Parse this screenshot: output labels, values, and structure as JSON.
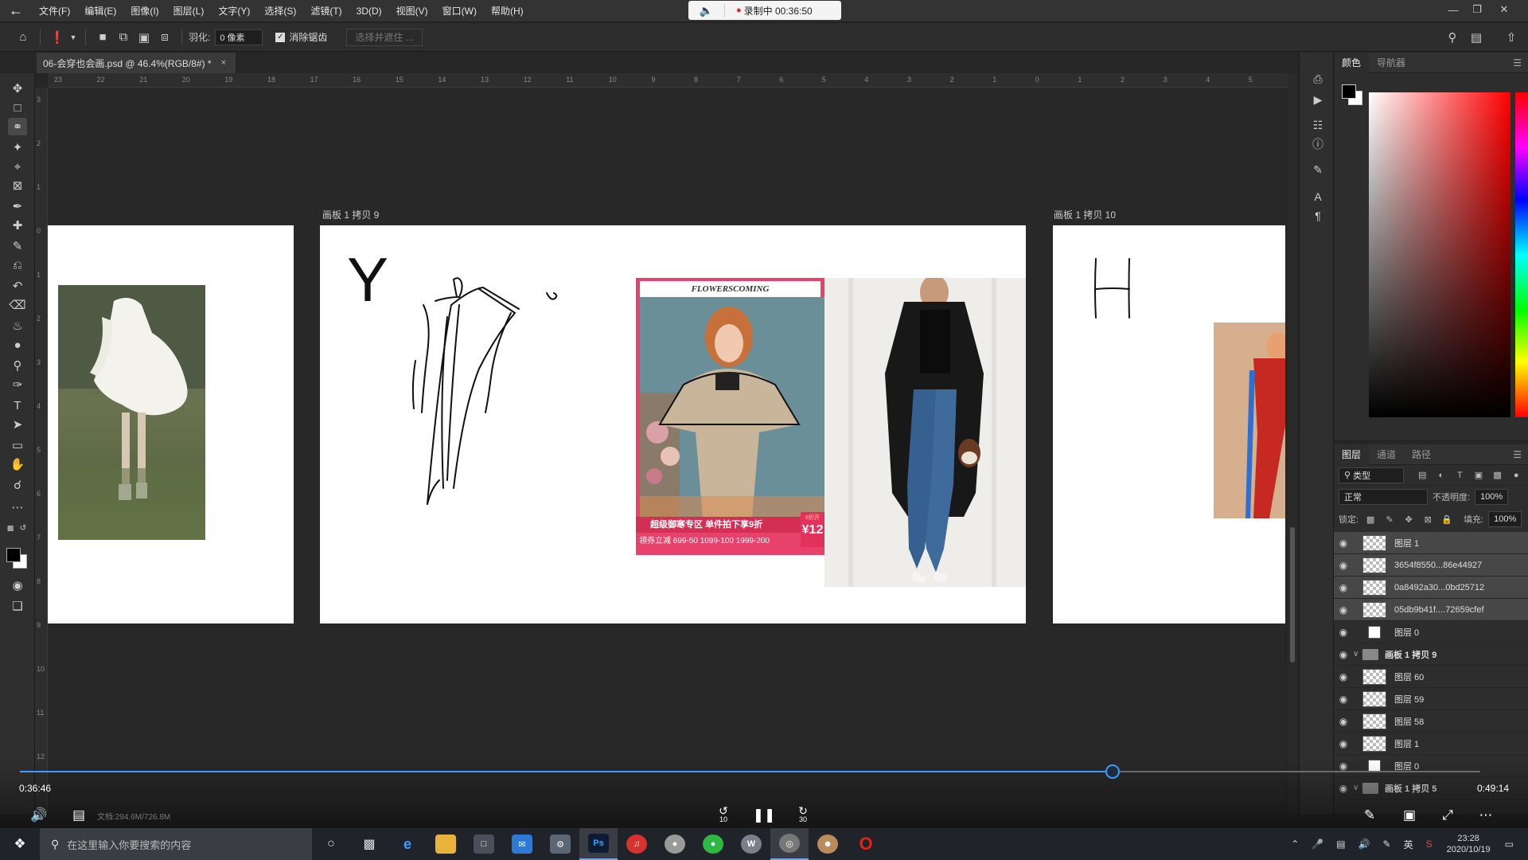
{
  "menubar": {
    "items": [
      "文件(F)",
      "编辑(E)",
      "图像(I)",
      "图层(L)",
      "文字(Y)",
      "选择(S)",
      "滤镜(T)",
      "3D(D)",
      "视图(V)",
      "窗口(W)",
      "帮助(H)"
    ],
    "recording": "录制中 00:36:50"
  },
  "options": {
    "feather_label": "羽化:",
    "feather_value": "0 像素",
    "antialias_label": "消除锯齿",
    "select_mask_label": "选择并遮住 ..."
  },
  "document": {
    "tab_title": "06-会穿也会画.psd @ 46.4%(RGB/8#) *",
    "tab_close": "×"
  },
  "ruler": {
    "top_ticks": [
      "23",
      "22",
      "21",
      "20",
      "19",
      "18",
      "17",
      "16",
      "15",
      "14",
      "13",
      "12",
      "11",
      "10",
      "9",
      "8",
      "7",
      "6",
      "5",
      "4",
      "3",
      "2",
      "1",
      "0",
      "1",
      "2",
      "3",
      "4",
      "5"
    ],
    "left_ticks": [
      "3",
      "2",
      "1",
      "0",
      "1",
      "2",
      "3",
      "4",
      "5",
      "6",
      "7",
      "8",
      "9",
      "10",
      "11",
      "12"
    ]
  },
  "artboards": {
    "center_label": "画板 1 拷贝 9",
    "right_label": "画板 1 拷贝 10",
    "sketch_letter_left": "Y",
    "sketch_letter_right": "H",
    "ad_brand": "FLOWERSCOMING",
    "ad_banner": "超级御寒专区  单件拍下享9折",
    "ad_deals": "领券立减 699-50 1099-100 1999-200",
    "ad_price": "¥12",
    "ad_tag": "9折开"
  },
  "color_panel": {
    "tabs": [
      "颜色",
      "导航器"
    ]
  },
  "layers_panel": {
    "tabs": [
      "图层",
      "通道",
      "路径"
    ],
    "filter_kind": "类型",
    "blend_mode": "正常",
    "opacity_label": "不透明度:",
    "opacity_value": "100%",
    "lock_label": "锁定:",
    "fill_label": "填充:",
    "fill_value": "100%",
    "layers": [
      {
        "name": "图层 1",
        "type": "layer",
        "selected": true
      },
      {
        "name": "3654f8550...86e44927",
        "type": "smart",
        "selected": true
      },
      {
        "name": "0a8492a30...0bd25712",
        "type": "smart",
        "selected": true
      },
      {
        "name": "05db9b41f....72659cfef",
        "type": "smart",
        "selected": true
      },
      {
        "name": "图层 0",
        "type": "white",
        "selected": false
      },
      {
        "name": "画板 1 拷贝 9",
        "type": "group",
        "selected": false
      },
      {
        "name": "图层 60",
        "type": "layer",
        "selected": false
      },
      {
        "name": "图层 59",
        "type": "layer",
        "selected": false
      },
      {
        "name": "图层 58",
        "type": "layer",
        "selected": false
      },
      {
        "name": "图层 1",
        "type": "layer",
        "selected": false
      },
      {
        "name": "图层 0",
        "type": "white",
        "selected": false
      },
      {
        "name": "画板 1 拷贝 5",
        "type": "group",
        "selected": false
      }
    ]
  },
  "player": {
    "current_time": "0:36:46",
    "total_time": "0:49:14",
    "progress": 0.7485,
    "rewind_label": "10",
    "forward_label": "30",
    "doc_status": "文档:294.6M/726.8M"
  },
  "taskbar": {
    "search_placeholder": "在这里输入你要搜索的内容",
    "time": "23:28",
    "date": "2020/10/19",
    "ime": "英"
  },
  "colors": {
    "accent_blue": "#3d9bff",
    "recording_red": "#e22222",
    "ad_pink": "#e7426b"
  }
}
